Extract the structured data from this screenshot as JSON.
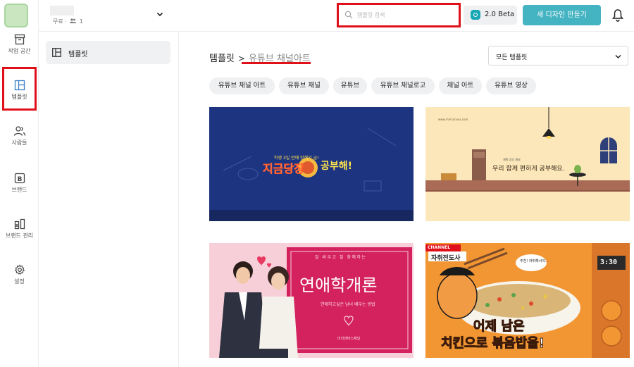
{
  "rail": {
    "items": [
      {
        "label": "작업 공간",
        "icon": "archive-icon"
      },
      {
        "label": "템플릿",
        "icon": "template-icon"
      },
      {
        "label": "사람들",
        "icon": "people-icon"
      },
      {
        "label": "브랜드",
        "icon": "brand-b-icon"
      },
      {
        "label": "브랜드 관리",
        "icon": "brand-manage-icon"
      },
      {
        "label": "설정",
        "icon": "gear-icon"
      }
    ]
  },
  "header": {
    "plan_label": "무료 ·",
    "member_count": "1",
    "search_placeholder": "템플릿 검색",
    "beta_label": "2.0 Beta",
    "new_design_label": "새 디자인 만들기"
  },
  "subnav": {
    "item_label": "템플릿"
  },
  "main": {
    "breadcrumb_root": "템플릿",
    "breadcrumb_sep": ">",
    "breadcrumb_current": "유튜브 채널아트",
    "filter_value": "모든 템플릿",
    "chips": [
      "유튜브 채널 아트",
      "유튜브 채널",
      "유튜브",
      "유튜브 채널로고",
      "채널 아트",
      "유튜브 영상"
    ]
  },
  "cards": {
    "card1": {
      "tagline": "학생 3일 만에 망해서 급!",
      "title_a": "지금당장",
      "title_b": "공부해!"
    },
    "card2": {
      "url": "www.miricanvas.com",
      "small": "재택 공부 채널",
      "title": "우리 함께 편하게 공부해요."
    },
    "card3": {
      "subtitle": "잘 싸우고 잘 화해하는",
      "title": "연애학개론",
      "caption": "연애하고싶은 남녀 배우는 방법",
      "footer": "미리캔버스채널"
    },
    "card4": {
      "badge": "CHANNEL",
      "channel_name": "자취전도사",
      "bubble": "추천! 자취해서야…",
      "timer": "3:30",
      "line1": "어제 남은",
      "line2": "치킨으로 볶음밥을!"
    }
  },
  "colors": {
    "accent": "#44b3c2",
    "highlight": "#e0101a"
  }
}
